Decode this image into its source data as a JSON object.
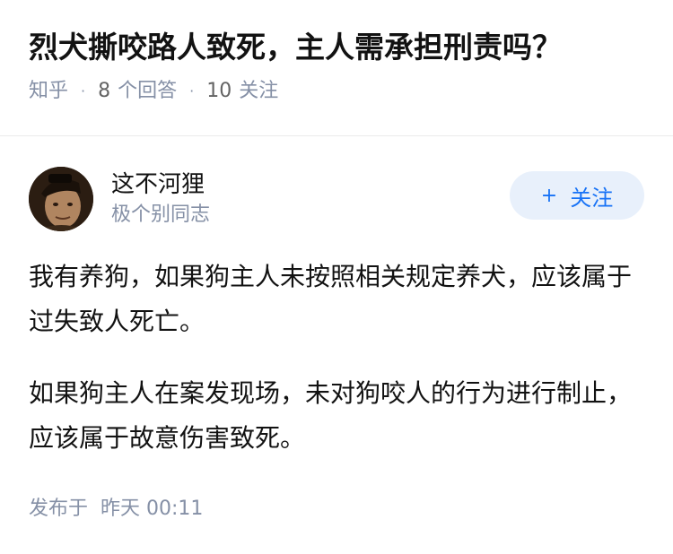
{
  "question": {
    "title": "烈犬撕咬路人致死，主人需承担刑责吗？",
    "source": "知乎",
    "answer_count": "8",
    "answer_label": "个回答",
    "follower_count": "10",
    "follower_label": "关注"
  },
  "answer": {
    "author": {
      "name": "这不河狸",
      "bio": "极个别同志",
      "follow_label": "关注",
      "follow_plus": "+"
    },
    "paragraphs": [
      "我有养狗，如果狗主人未按照相关规定养犬，应该属于过失致人死亡。",
      "如果狗主人在案发现场，未对狗咬人的行为进行制止，应该属于故意伤害致死。"
    ],
    "publish_label": "发布于",
    "publish_time": "昨天 00:11"
  },
  "colors": {
    "meta_gray": "#8590a6",
    "brand_blue": "#1772f6",
    "follow_bg": "#e8f0fb"
  }
}
